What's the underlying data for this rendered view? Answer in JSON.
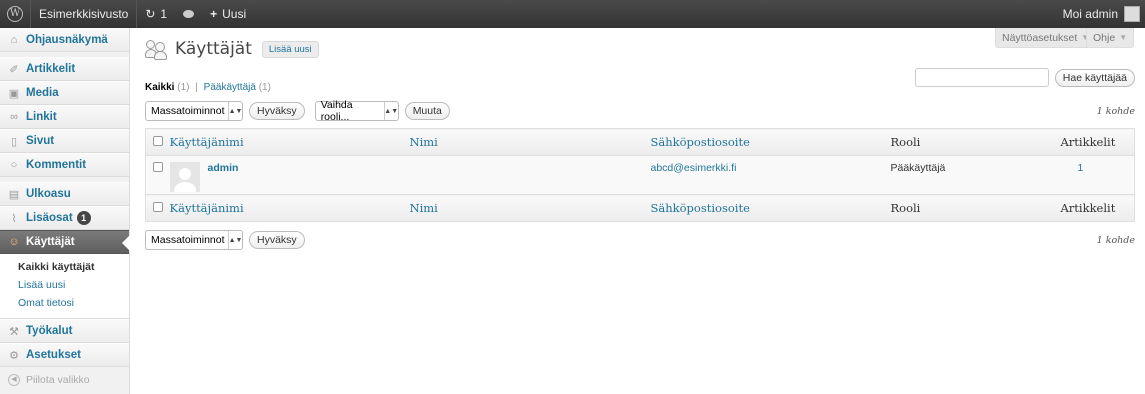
{
  "adminbar": {
    "site_name": "Esimerkkisivusto",
    "updates_count": "1",
    "new_label": "Uusi",
    "account_label": "Moi admin"
  },
  "sidebar": {
    "items": [
      {
        "label": "Ohjausnäkymä",
        "icon": "dashboard-icon"
      },
      {
        "label": "Artikkelit",
        "icon": "pin-icon"
      },
      {
        "label": "Media",
        "icon": "media-icon"
      },
      {
        "label": "Linkit",
        "icon": "link-icon"
      },
      {
        "label": "Sivut",
        "icon": "page-icon"
      },
      {
        "label": "Kommentit",
        "icon": "comment-icon"
      },
      {
        "label": "Ulkoasu",
        "icon": "appearance-icon"
      },
      {
        "label": "Lisäosat",
        "icon": "plugin-icon",
        "badge": "1"
      },
      {
        "label": "Käyttäjät",
        "icon": "users-icon"
      },
      {
        "label": "Työkalut",
        "icon": "tools-icon"
      },
      {
        "label": "Asetukset",
        "icon": "settings-icon"
      }
    ],
    "submenu": [
      "Kaikki käyttäjät",
      "Lisää uusi",
      "Omat tietosi"
    ],
    "collapse_label": "Piilota valikko"
  },
  "screen_meta": {
    "options_label": "Näyttöasetukset",
    "help_label": "Ohje"
  },
  "page": {
    "title": "Käyttäjät",
    "add_new": "Lisää uusi",
    "filter_all": "Kaikki",
    "filter_all_count": "(1)",
    "filter_sep": "|",
    "filter_admin": "Pääkäyttäjä",
    "filter_admin_count": "(1)",
    "search_button": "Hae käyttäjää",
    "search_value": ""
  },
  "bulk": {
    "actions_select": "Massatoiminnot",
    "apply_button": "Hyväksy",
    "role_select": "Vaihda rooli...",
    "change_button": "Muuta",
    "item_count": "1 kohde"
  },
  "table": {
    "columns": [
      "Käyttäjänimi",
      "Nimi",
      "Sähköpostiosoite",
      "Rooli",
      "Artikkelit"
    ],
    "rows": [
      {
        "username": "admin",
        "name": "",
        "email": "abcd@esimerkki.fi",
        "role": "Pääkäyttäjä",
        "posts": "1"
      }
    ]
  }
}
